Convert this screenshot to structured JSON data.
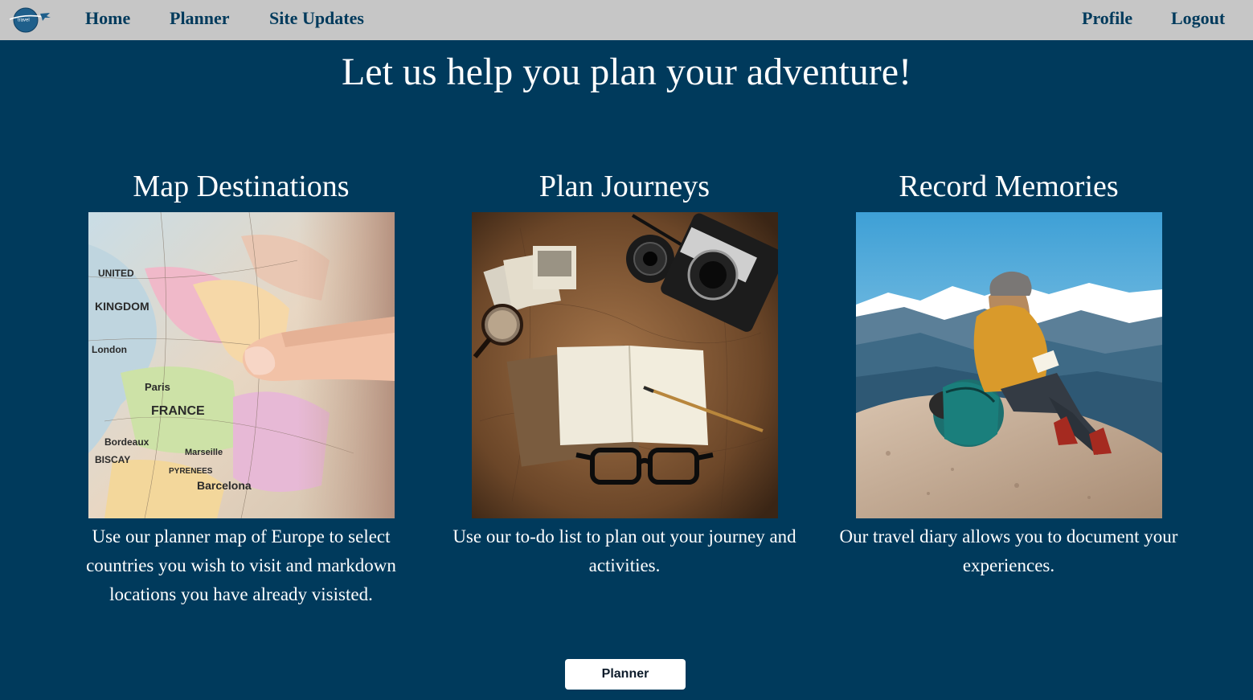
{
  "nav": {
    "logo_icon": "airplane-globe-logo-icon",
    "logo_text": "travel",
    "left_links": [
      "Home",
      "Planner",
      "Site Updates"
    ],
    "right_links": [
      "Profile",
      "Logout"
    ]
  },
  "hero": {
    "title": "Let us help you plan your adventure!"
  },
  "features": [
    {
      "title": "Map Destinations",
      "image": "europe-map-with-finger-photo",
      "description": "Use our planner map of Europe to select countries you wish to visit and markdown locations you have already visisted."
    },
    {
      "title": "Plan Journeys",
      "image": "notebook-camera-glasses-on-map-photo",
      "description": "Use our to-do list to plan out your journey and activities."
    },
    {
      "title": "Record Memories",
      "image": "hiker-writing-on-mountain-photo",
      "description": "Our travel diary allows you to document your experiences."
    }
  ],
  "cta": {
    "label": "Planner"
  },
  "colors": {
    "background": "#003a5c",
    "navbar": "#c6c6c6",
    "nav_text": "#003a5c",
    "text": "#ffffff",
    "button_bg": "#ffffff"
  }
}
